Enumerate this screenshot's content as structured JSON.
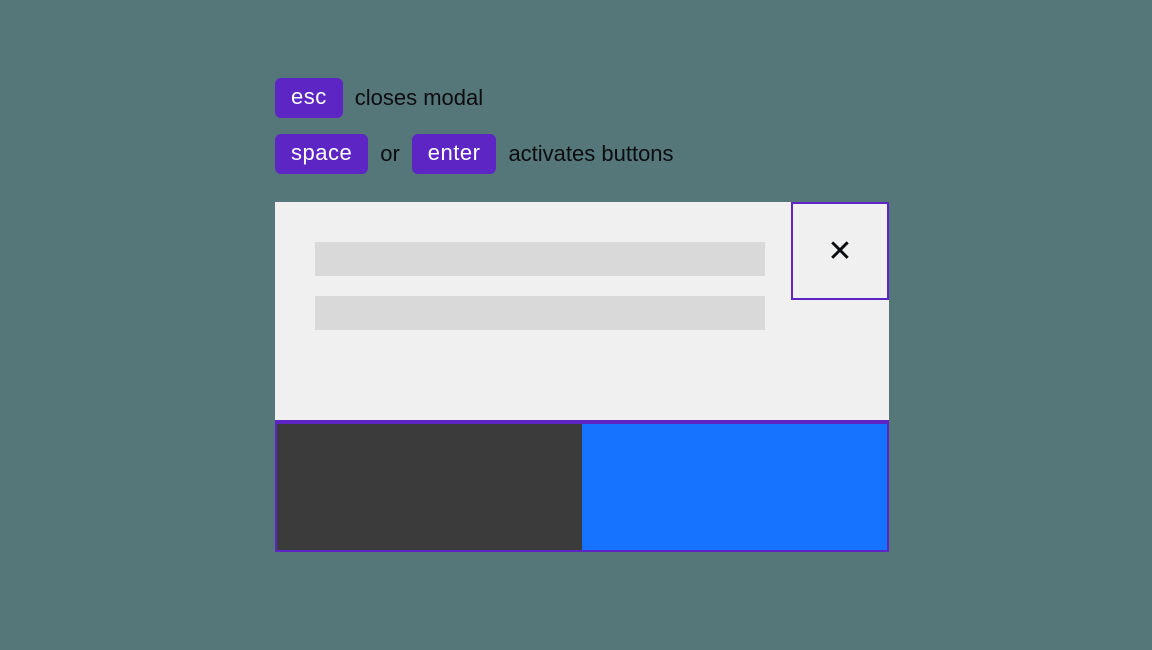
{
  "hints": [
    {
      "keys": [
        "esc"
      ],
      "separator": "",
      "desc": "closes modal"
    },
    {
      "keys": [
        "space",
        "enter"
      ],
      "separator": "or",
      "desc": "activates buttons"
    }
  ],
  "modal": {
    "close_symbol": "✕",
    "placeholders": 2,
    "footer_buttons": [
      {
        "name": "secondary-button",
        "color": "dark"
      },
      {
        "name": "primary-button",
        "color": "blue"
      }
    ]
  },
  "colors": {
    "bg": "#56777a",
    "accent": "#5c25c4",
    "modal_bg": "#f0f0f0",
    "placeholder": "#d9d9d9",
    "footer_dark": "#3b3b3b",
    "footer_blue": "#1673ff"
  }
}
